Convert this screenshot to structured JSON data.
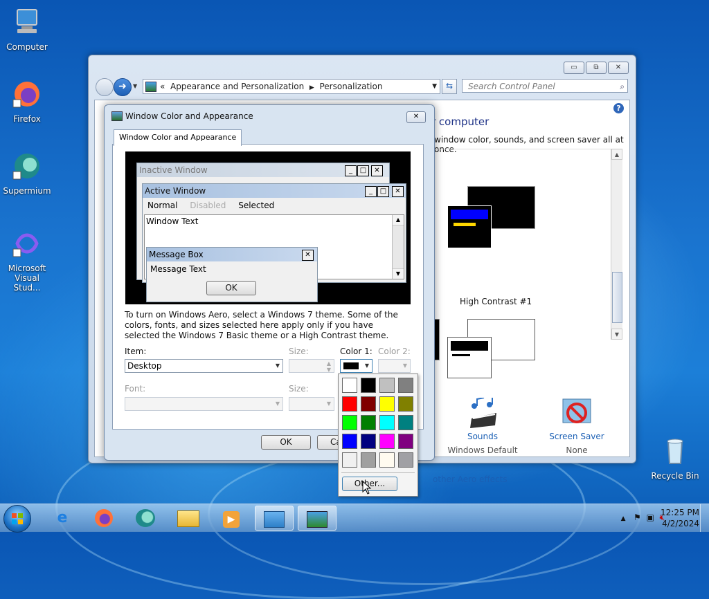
{
  "desktop": {
    "icons": [
      {
        "label": "Computer"
      },
      {
        "label": "Firefox"
      },
      {
        "label": "Supermium"
      },
      {
        "label": "Microsoft Visual Stud..."
      },
      {
        "label": "Recycle Bin"
      }
    ]
  },
  "control_panel": {
    "breadcrumb": [
      "Appearance and Personalization",
      "Personalization"
    ],
    "breadcrumb_prefix": "«",
    "search_placeholder": "Search Control Panel",
    "heading_partial": "r computer",
    "subtitle_partial": "window color, sounds, and screen saver all at once.",
    "theme_label": "High Contrast #1",
    "sounds": {
      "title": "Sounds",
      "value": "Windows Default"
    },
    "screensaver": {
      "title": "Screen Saver",
      "value": "None"
    },
    "aero_link": "other Aero effects",
    "win_buttons": [
      "▭",
      "⧉",
      "✕"
    ]
  },
  "dialog": {
    "title": "Window Color and Appearance",
    "tab": "Window Color and Appearance",
    "preview": {
      "inactive_title": "Inactive Window",
      "active_title": "Active Window",
      "menu": [
        "Normal",
        "Disabled",
        "Selected"
      ],
      "window_text": "Window Text",
      "msgbox_title": "Message Box",
      "msgbox_text": "Message Text",
      "ok": "OK"
    },
    "info_text": "To turn on Windows Aero, select a Windows 7 theme.  Some of the colors, fonts, and sizes selected here apply only if you have selected the Windows 7 Basic theme or a High Contrast theme.",
    "item_label": "Item:",
    "item_value": "Desktop",
    "size_label": "Size:",
    "color1_label": "Color 1:",
    "color2_label": "Color 2:",
    "font_label": "Font:",
    "font_size_label": "Size:",
    "ok_button": "OK",
    "cancel_button_partial": "Ca",
    "color1_value": "#000000"
  },
  "color_popup": {
    "colors": [
      "#ffffff",
      "#000000",
      "#c0c0c0",
      "#808080",
      "#ff0000",
      "#800000",
      "#ffff00",
      "#808000",
      "#00ff00",
      "#008000",
      "#00ffff",
      "#008080",
      "#0000ff",
      "#000080",
      "#ff00ff",
      "#800080",
      "#f0f0f0",
      "#a0a0a0",
      "#fffbf0",
      "#a0a0a4"
    ],
    "other_button": "Other..."
  },
  "taskbar": {
    "time": "12:25 PM",
    "date": "4/2/2024"
  }
}
